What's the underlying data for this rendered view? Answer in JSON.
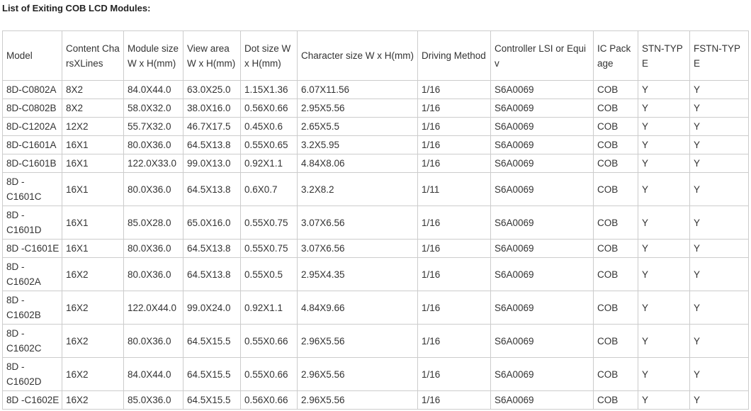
{
  "page": {
    "title": "List of Exiting COB LCD Modules:"
  },
  "table": {
    "headers": [
      "Model",
      "Content CharsXLines",
      "Module size W x H(mm)",
      "View area W x H(mm)",
      "Dot size W x H(mm)",
      "Character size W x H(mm)",
      "Driving Method",
      "Controller LSI or Equiv",
      "IC Package",
      "STN-TYPE",
      "FSTN-TYPE"
    ],
    "rows": [
      [
        "8D-C0802A",
        "8X2",
        "84.0X44.0",
        "63.0X25.0",
        "1.15X1.36",
        "6.07X11.56",
        "1/16",
        "S6A0069",
        "COB",
        "Y",
        "Y"
      ],
      [
        "8D-C0802B",
        "8X2",
        "58.0X32.0",
        "38.0X16.0",
        "0.56X0.66",
        "2.95X5.56",
        "1/16",
        "S6A0069",
        "COB",
        "Y",
        "Y"
      ],
      [
        "8D-C1202A",
        "12X2",
        "55.7X32.0",
        "46.7X17.5",
        "0.45X0.6",
        "2.65X5.5",
        "1/16",
        "S6A0069",
        "COB",
        "Y",
        "Y"
      ],
      [
        "8D-C1601A",
        "16X1",
        "80.0X36.0",
        "64.5X13.8",
        "0.55X0.65",
        "3.2X5.95",
        "1/16",
        "S6A0069",
        "COB",
        "Y",
        "Y"
      ],
      [
        "8D-C1601B",
        "16X1",
        "122.0X33.0",
        "99.0X13.0",
        "0.92X1.1",
        "4.84X8.06",
        "1/16",
        "S6A0069",
        "COB",
        "Y",
        "Y"
      ],
      [
        "8D - C1601C",
        "16X1",
        "80.0X36.0",
        "64.5X13.8",
        "0.6X0.7",
        "3.2X8.2",
        "1/11",
        "S6A0069",
        "COB",
        "Y",
        "Y"
      ],
      [
        "8D - C1601D",
        "16X1",
        "85.0X28.0",
        "65.0X16.0",
        "0.55X0.75",
        "3.07X6.56",
        "1/16",
        "S6A0069",
        "COB",
        "Y",
        "Y"
      ],
      [
        "8D -C1601E",
        "16X1",
        "80.0X36.0",
        "64.5X13.8",
        "0.55X0.75",
        "3.07X6.56",
        "1/16",
        "S6A0069",
        "COB",
        "Y",
        "Y"
      ],
      [
        "8D - C1602A",
        "16X2",
        "80.0X36.0",
        "64.5X13.8",
        "0.55X0.5",
        "2.95X4.35",
        "1/16",
        "S6A0069",
        "COB",
        "Y",
        "Y"
      ],
      [
        "8D - C1602B",
        "16X2",
        "122.0X44.0",
        "99.0X24.0",
        "0.92X1.1",
        "4.84X9.66",
        "1/16",
        "S6A0069",
        "COB",
        "Y",
        "Y"
      ],
      [
        "8D - C1602C",
        "16X2",
        "80.0X36.0",
        "64.5X15.5",
        "0.55X0.66",
        "2.96X5.56",
        "1/16",
        "S6A0069",
        "COB",
        "Y",
        "Y"
      ],
      [
        "8D - C1602D",
        "16X2",
        "84.0X44.0",
        "64.5X15.5",
        "0.55X0.66",
        "2.96X5.56",
        "1/16",
        "S6A0069",
        "COB",
        "Y",
        "Y"
      ],
      [
        "8D -C1602E",
        "16X2",
        "85.0X36.0",
        "64.5X15.5",
        "0.56X0.66",
        "2.96X5.56",
        "1/16",
        "S6A0069",
        "COB",
        "Y",
        "Y"
      ]
    ]
  }
}
